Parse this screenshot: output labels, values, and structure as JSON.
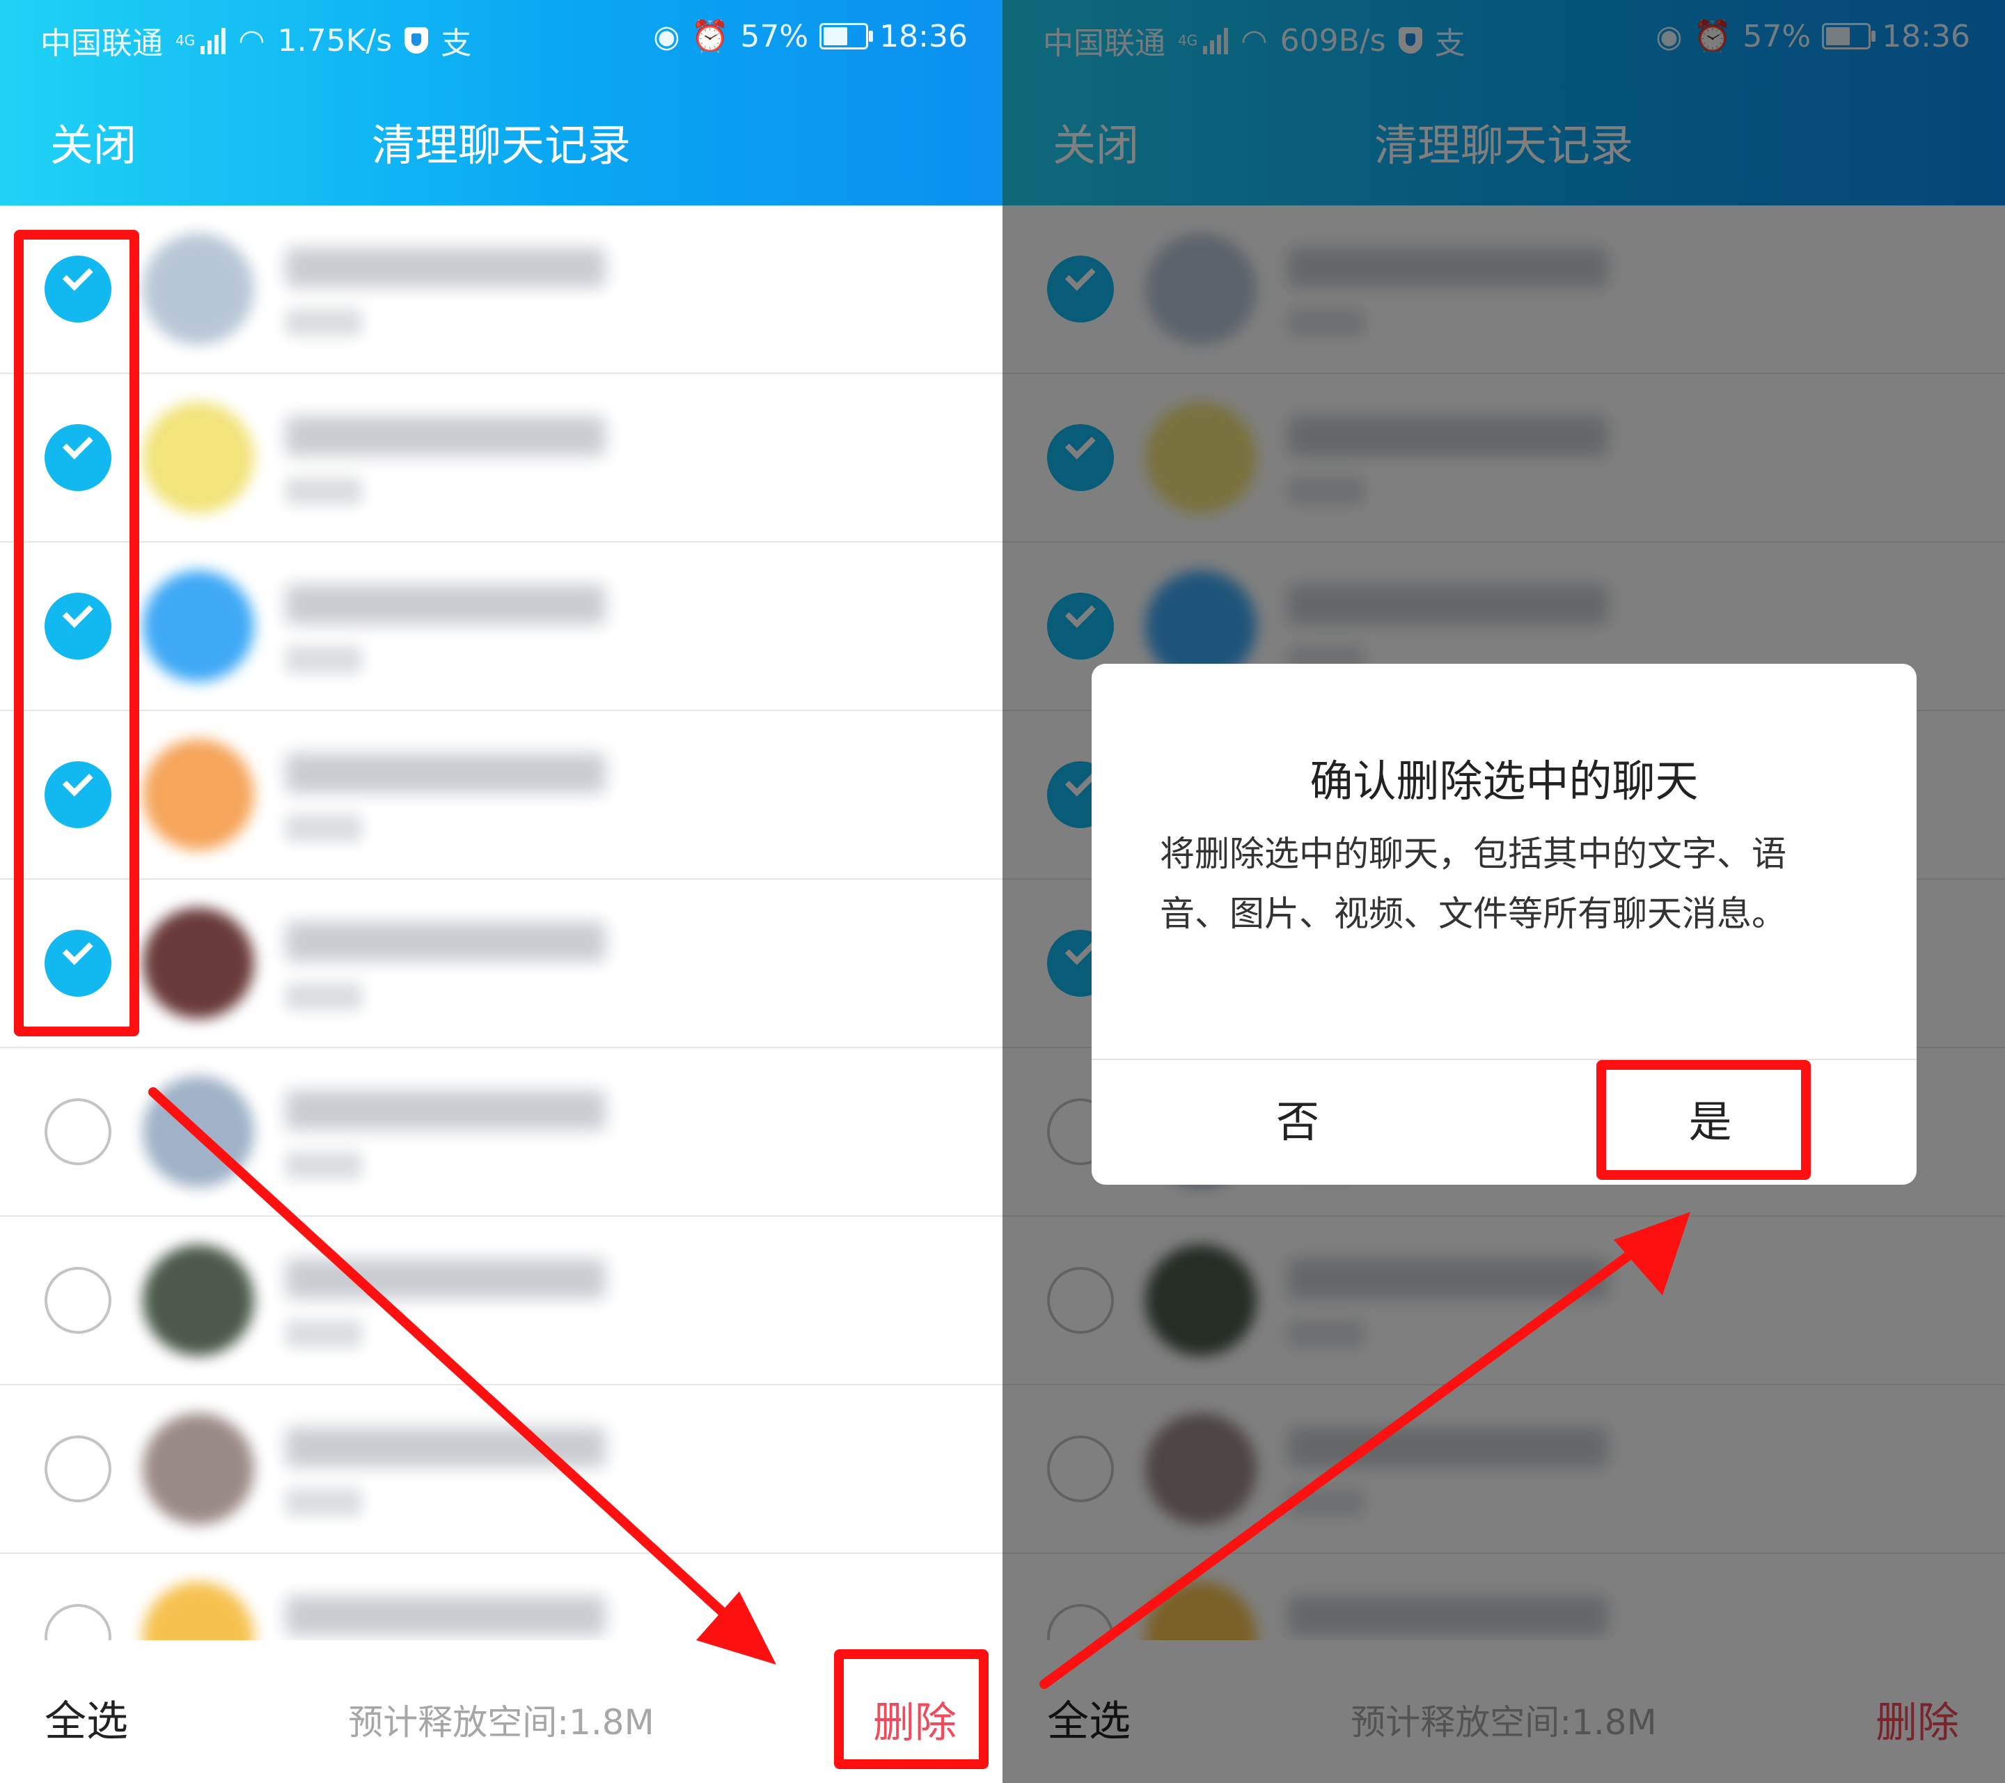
{
  "left_screen": {
    "status": {
      "carrier": "中国联通",
      "network_badge": "4G",
      "speed": "1.75K/s",
      "battery": "57%",
      "time": "18:36",
      "pay_glyph": "支"
    },
    "header": {
      "close_label": "关闭",
      "title": "清理聊天记录"
    },
    "rows": [
      {
        "checked": true,
        "avatar_color": "#b8c7d6"
      },
      {
        "checked": true,
        "avatar_color": "#f2e37a"
      },
      {
        "checked": true,
        "avatar_color": "#3ea9f5"
      },
      {
        "checked": true,
        "avatar_color": "#f6a55b"
      },
      {
        "checked": true,
        "avatar_color": "#6a3a3a"
      },
      {
        "checked": false,
        "avatar_color": "#9fb2c7"
      },
      {
        "checked": false,
        "avatar_color": "#4b5a4b"
      },
      {
        "checked": false,
        "avatar_color": "#9a8a86"
      },
      {
        "checked": false,
        "avatar_color": "#f6c14f"
      }
    ],
    "bottom": {
      "select_all": "全选",
      "estimate": "预计释放空间:1.8M",
      "delete": "删除"
    }
  },
  "right_screen": {
    "status": {
      "carrier": "中国联通",
      "network_badge": "4G",
      "speed": "609B/s",
      "battery": "57%",
      "time": "18:36",
      "pay_glyph": "支"
    },
    "header": {
      "close_label": "关闭",
      "title": "清理聊天记录"
    },
    "bottom": {
      "select_all": "全选",
      "estimate": "预计释放空间:1.8M",
      "delete": "删除"
    },
    "dialog": {
      "title": "确认删除选中的聊天",
      "body": "将删除选中的聊天，包括其中的文字、语音、图片、视频、文件等所有聊天消息。",
      "no": "否",
      "yes": "是"
    }
  },
  "colors": {
    "accent": "#12b8f0",
    "delete": "#f04b5b",
    "annotation": "#ff1010"
  }
}
